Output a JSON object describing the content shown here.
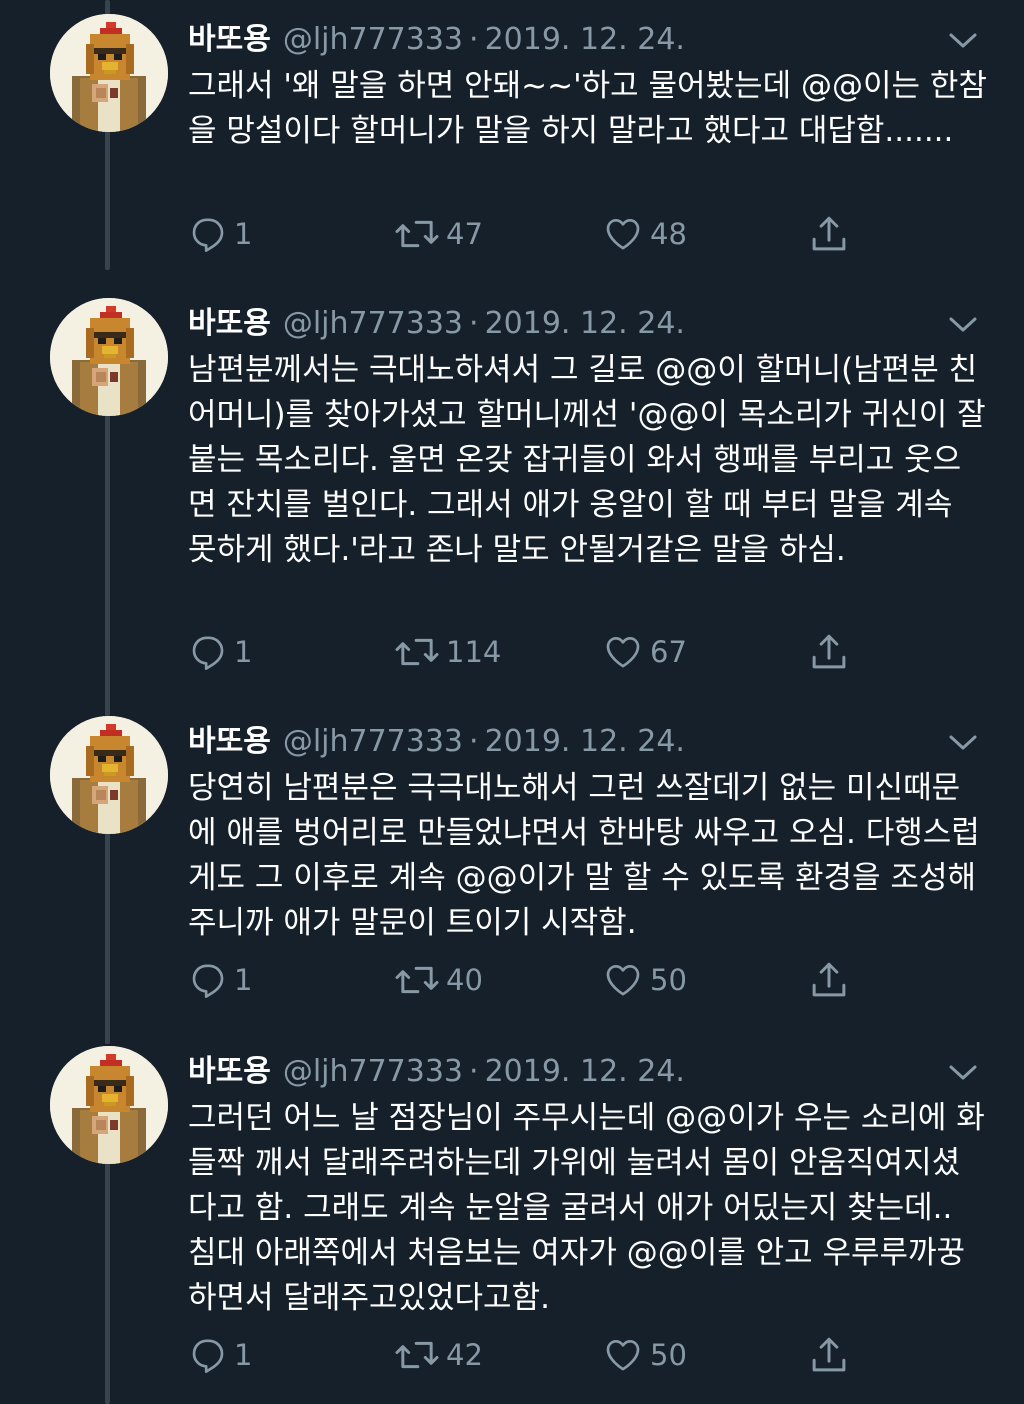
{
  "colors": {
    "background": "#15202b",
    "text": "#ffffff",
    "muted": "#8899a6",
    "thread_line": "#38444d"
  },
  "tweets": [
    {
      "name": "바또용",
      "handle": "@ljh777333",
      "separator": "·",
      "date": "2019. 12. 24.",
      "text": "그래서 '왜 말을 하면 안돼~~'하고 물어봤는데 @@이는 한참을 망설이다 할머니가 말을 하지 말라고 했다고 대답함.......",
      "replies": "1",
      "retweets": "47",
      "likes": "48",
      "icons": [
        "avatar-icon",
        "chevron-down-icon",
        "reply-icon",
        "retweet-icon",
        "heart-icon",
        "share-icon"
      ]
    },
    {
      "name": "바또용",
      "handle": "@ljh777333",
      "separator": "·",
      "date": "2019. 12. 24.",
      "text": "남편분께서는 극대노하셔서 그 길로 @@이 할머니(남편분 친어머니)를 찾아가셨고 할머니께선 '@@이 목소리가 귀신이 잘 붙는 목소리다. 울면 온갖 잡귀들이 와서 행패를 부리고 웃으면 잔치를 벌인다. 그래서 애가 옹알이 할 때 부터 말을 계속 못하게 했다.'라고 존나 말도 안될거같은 말을 하심.",
      "replies": "1",
      "retweets": "114",
      "likes": "67"
    },
    {
      "name": "바또용",
      "handle": "@ljh777333",
      "separator": "·",
      "date": "2019. 12. 24.",
      "text": "당연히 남편분은 극극대노해서 그런 쓰잘데기 없는 미신때문에 애를 벙어리로 만들었냐면서 한바탕 싸우고 오심. 다행스럽게도 그 이후로 계속 @@이가 말 할 수 있도록 환경을 조성해주니까 애가 말문이 트이기 시작함.",
      "replies": "1",
      "retweets": "40",
      "likes": "50"
    },
    {
      "name": "바또용",
      "handle": "@ljh777333",
      "separator": "·",
      "date": "2019. 12. 24.",
      "text": "그러던 어느 날 점장님이 주무시는데 @@이가 우는 소리에 화들짝 깨서 달래주려하는데 가위에 눌려서 몸이 안움직여지셨다고 함. 그래도 계속 눈알을 굴려서 애가 어딨는지 찾는데.. 침대 아래쪽에서 처음보는 여자가 @@이를 안고 우루루까꿍하면서 달래주고있었다고함.",
      "replies": "1",
      "retweets": "42",
      "likes": "50"
    }
  ]
}
